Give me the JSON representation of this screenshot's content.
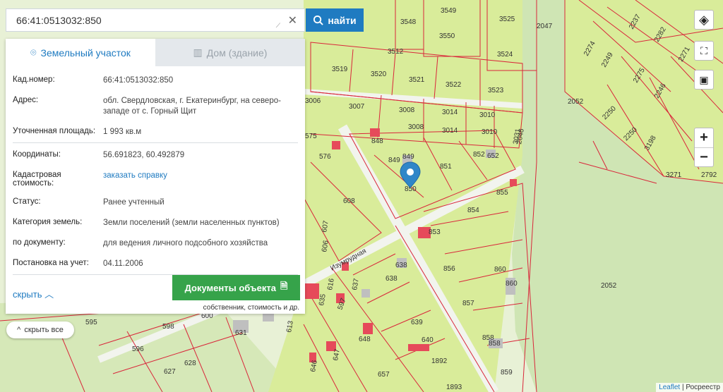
{
  "search": {
    "value": "66:41:0513032:850",
    "button_label": "найти"
  },
  "tabs": {
    "parcel": "Земельный участок",
    "building": "Дом (здание)"
  },
  "info": [
    {
      "key": "Кад.номер:",
      "value": "66:41:0513032:850"
    },
    {
      "key": "Адрес:",
      "value": "обл. Свердловская, г. Екатеринбург, на северо-западе от с. Горный Щит"
    },
    {
      "key": "Уточненная площадь:",
      "value": "1 993 кв.м"
    },
    {
      "key": "Координаты:",
      "value": "56.691823, 60.492879"
    },
    {
      "key": "Кадастровая стоимость:",
      "value": "заказать справку"
    },
    {
      "key": "Статус:",
      "value": "Ранее учтенный"
    },
    {
      "key": "Категория земель:",
      "value": "Земли поселений (земли населенных пунктов)"
    },
    {
      "key": "по документу:",
      "value": "для ведения личного подсобного хозяйства"
    },
    {
      "key": "Постановка на учет:",
      "value": "04.11.2006"
    }
  ],
  "panel": {
    "hide_label": "скрыть",
    "docs_label": "Документы объекта",
    "docs_note": "собственник, стоимость и др."
  },
  "hide_all_label": "скрыть все",
  "attribution": {
    "leaflet": "Leaflet",
    "source": "Росреестр"
  },
  "street_label": "Изумрудная",
  "parcel_labels": [
    "3549",
    "3548",
    "3550",
    "3525",
    "3524",
    "3512",
    "3519",
    "3520",
    "3521",
    "3522",
    "3523",
    "3007",
    "3008",
    "3014",
    "3010",
    "3008",
    "3014",
    "3010",
    "848",
    "849",
    "851",
    "852",
    "850",
    "855",
    "854",
    "853",
    "856",
    "860",
    "857",
    "858",
    "859",
    "1892",
    "1893",
    "576",
    "608",
    "638",
    "638",
    "639",
    "640",
    "648",
    "657",
    "2047",
    "2046",
    "3031",
    "2052",
    "2052",
    "2250",
    "2250",
    "2249",
    "2275",
    "2246",
    "2274",
    "2237",
    "2282",
    "2271",
    "3198",
    "3271",
    "2792",
    "595",
    "598",
    "600",
    "596",
    "627",
    "628",
    "631",
    "616",
    "637",
    "613",
    "635",
    "646",
    "647",
    "606",
    "607",
    "575",
    "3006",
    "652",
    "860"
  ],
  "colors": {
    "parcel_fill": "#d9ec9a",
    "forest": "#cfe5b4",
    "boundary": "#d9263a",
    "selected_marker": "#2f86c8",
    "building": "#e64a5a"
  }
}
